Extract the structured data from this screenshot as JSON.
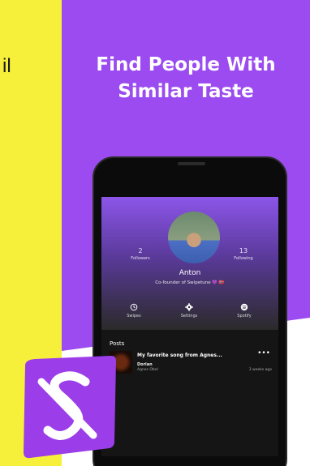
{
  "left_panel": {
    "text_fragment": "il"
  },
  "headline": {
    "line1": "Find People With",
    "line2": "Similar Taste"
  },
  "colors": {
    "promo_bg": "#9b4bf0",
    "yellow_bg": "#f7f03a",
    "phone_frame": "#0b0b0b"
  },
  "profile": {
    "followers_count": "2",
    "followers_label": "Followers",
    "following_count": "13",
    "following_label": "Following",
    "name": "Anton",
    "bio": "Co-founder of Swipetune 💜 🇳🇴"
  },
  "actions": [
    {
      "label": "Swipes",
      "icon": "history-icon"
    },
    {
      "label": "Settings",
      "icon": "gear-icon"
    },
    {
      "label": "Spotify",
      "icon": "spotify-icon"
    }
  ],
  "posts": {
    "title": "Posts",
    "items": [
      {
        "title": "My favorite song from Agnes...",
        "track": "Dorian",
        "artist": "Agnes Obel",
        "time": "3 weeks ago",
        "more_icon": "more-icon"
      }
    ]
  },
  "logo": {
    "icon": "swipetune-logo-icon"
  }
}
